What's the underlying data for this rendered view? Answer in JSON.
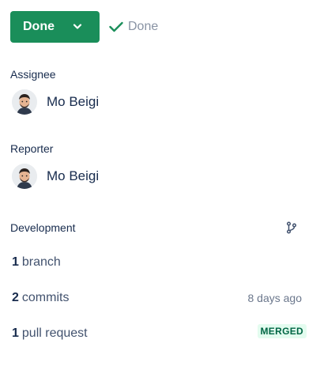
{
  "status": {
    "button_label": "Done",
    "hint_label": "Done"
  },
  "assignee": {
    "label": "Assignee",
    "name": "Mo Beigi"
  },
  "reporter": {
    "label": "Reporter",
    "name": "Mo Beigi"
  },
  "development": {
    "label": "Development",
    "branches": {
      "count": "1",
      "label": "branch"
    },
    "commits": {
      "count": "2",
      "label": "commits",
      "meta": "8 days ago"
    },
    "pull_requests": {
      "count": "1",
      "label": "pull request",
      "badge": "MERGED"
    }
  },
  "colors": {
    "primary_green": "#1a8e5a",
    "merged_badge_bg": "#e3fcef",
    "merged_badge_text": "#006644"
  },
  "icons": [
    "chevron-down-icon",
    "check-icon",
    "avatar",
    "branch-icon"
  ]
}
